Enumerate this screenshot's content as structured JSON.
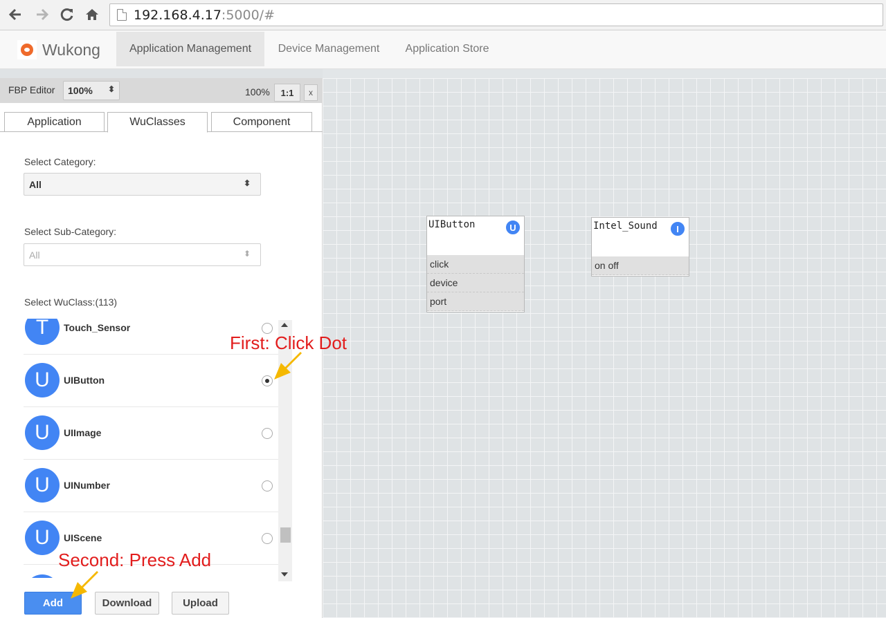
{
  "browser": {
    "back_icon": "arrow-left",
    "forward_icon": "arrow-right",
    "reload_icon": "reload",
    "home_icon": "home",
    "url_host": "192.168.4.17",
    "url_rest": ":5000/#"
  },
  "navbar": {
    "brand": "Wukong",
    "items": [
      "Application Management",
      "Device Management",
      "Application Store"
    ],
    "active_index": 0
  },
  "editor": {
    "label": "FBP Editor",
    "zoom_value": "100%",
    "zoom_readout": "100%",
    "ratio_label": "1:1",
    "close_label": "x"
  },
  "tabs": [
    "Application",
    "WuClasses",
    "Component"
  ],
  "active_tab": "WuClasses",
  "filters": {
    "category_label": "Select Category:",
    "category_value": "All",
    "subcategory_label": "Select Sub-Category:",
    "subcategory_value": "All",
    "wuclass_label": "Select WuClass:(113)"
  },
  "wuclasses": [
    {
      "letter": "T",
      "name": "Touch_Sensor",
      "selected": false
    },
    {
      "letter": "U",
      "name": "UIButton",
      "selected": true
    },
    {
      "letter": "U",
      "name": "UIImage",
      "selected": false
    },
    {
      "letter": "U",
      "name": "UINumber",
      "selected": false
    },
    {
      "letter": "U",
      "name": "UIScene",
      "selected": false
    }
  ],
  "buttons": {
    "add": "Add",
    "download": "Download",
    "upload": "Upload"
  },
  "canvas_blocks": [
    {
      "title": "UIButton",
      "badge": "U",
      "ports": [
        "click",
        "device",
        "port"
      ]
    },
    {
      "title": "Intel_Sound",
      "badge": "I",
      "ports": [
        "on off"
      ]
    }
  ],
  "annotations": {
    "first": "First: Click Dot",
    "second": "Second: Press Add",
    "arrow_color": "#f5b800"
  },
  "colors": {
    "accent_blue": "#4285f4",
    "annotation_red": "#e21d1d"
  }
}
